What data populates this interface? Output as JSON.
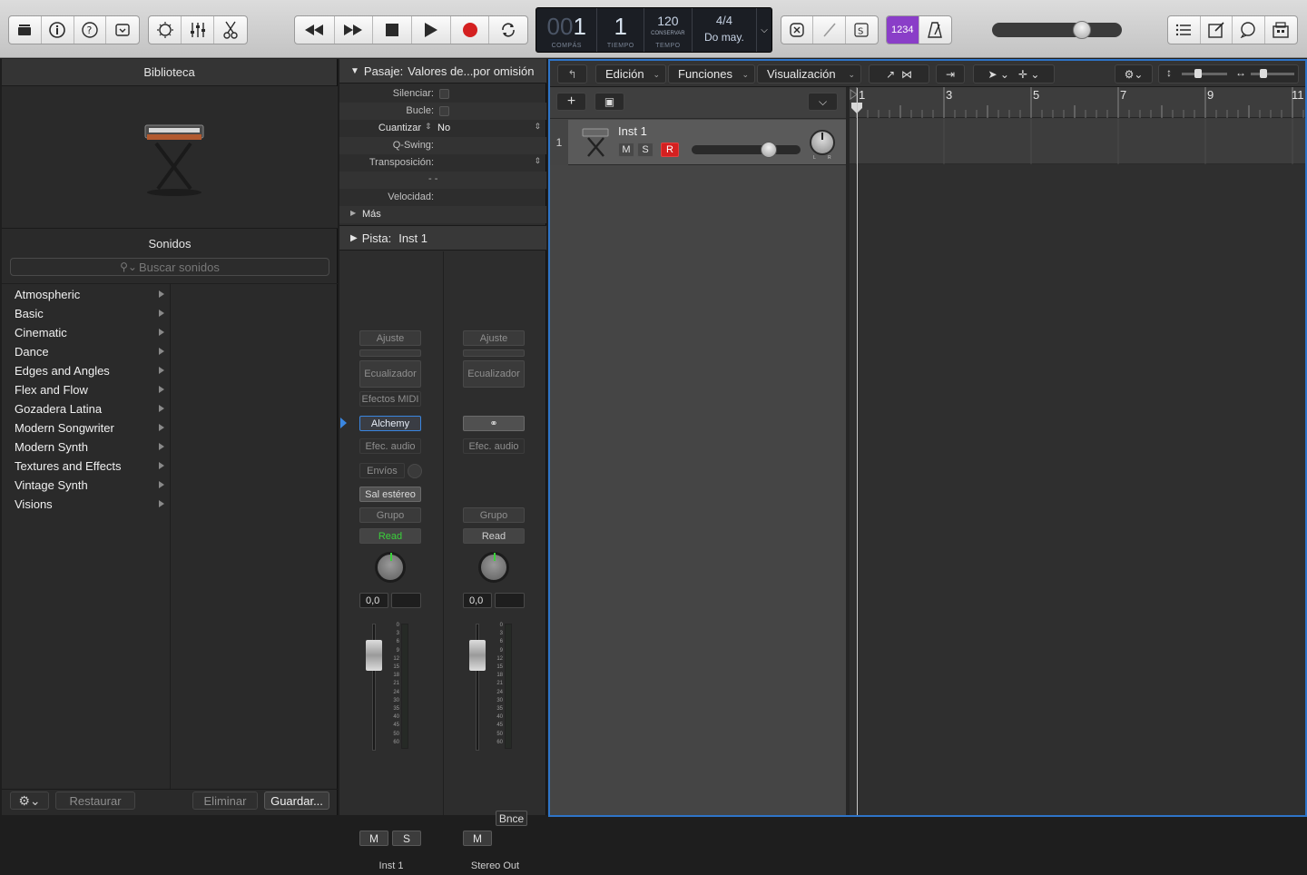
{
  "toolbar": {
    "left_icons": [
      "library-icon",
      "info-icon",
      "help-icon",
      "editor-toggle-icon"
    ],
    "mid_icons": [
      "smart-controls-icon",
      "mixer-icon",
      "scissors-icon"
    ],
    "transport": [
      "rewind-icon",
      "fast-forward-icon",
      "stop-icon",
      "play-icon",
      "record-icon",
      "cycle-icon"
    ],
    "lcd": {
      "bar_dim": "00",
      "bar": "1",
      "beat": "1",
      "bar_caption": "COMPÁS",
      "beat_caption": "TIEMPO",
      "tempo": "120",
      "tempo_caption1": "CONSERVAR",
      "tempo_caption2": "TEMPO",
      "signature": "4/4",
      "key": "Do may."
    },
    "countin": "1234",
    "master_volume": 0.7
  },
  "library": {
    "title": "Biblioteca",
    "sounds_title": "Sonidos",
    "search_placeholder": "Buscar sonidos",
    "categories": [
      "Atmospheric",
      "Basic",
      "Cinematic",
      "Dance",
      "Edges and Angles",
      "Flex and Flow",
      "Gozadera Latina",
      "Modern Songwriter",
      "Modern Synth",
      "Textures and Effects",
      "Vintage Synth",
      "Visions"
    ],
    "restore": "Restaurar",
    "delete": "Eliminar",
    "save": "Guardar..."
  },
  "inspector": {
    "region_label": "Pasaje:",
    "region_name": "Valores de...por omisión",
    "mute": "Silenciar:",
    "loop": "Bucle:",
    "quantize": "Cuantizar",
    "quantize_value": "No",
    "qswing": "Q-Swing:",
    "transpose": "Transposición:",
    "dash": "- -",
    "velocity": "Velocidad:",
    "more": "Más",
    "track_label": "Pista:",
    "track_name": "Inst 1",
    "strip1": {
      "setting": "Ajuste",
      "eq": "Ecualizador",
      "midi_fx": "Efectos MIDI",
      "instrument": "Alchemy",
      "audio_fx": "Efec. audio",
      "sends": "Envíos",
      "output": "Sal estéreo",
      "group": "Grupo",
      "automation": "Read",
      "volume": "0,0",
      "mute": "M",
      "solo": "S",
      "name": "Inst 1"
    },
    "strip2": {
      "setting": "Ajuste",
      "eq": "Ecualizador",
      "audio_fx": "Efec. audio",
      "group": "Grupo",
      "automation": "Read",
      "volume": "0,0",
      "bounce": "Bnce",
      "mute": "M",
      "name": "Stereo Out"
    },
    "meter_scale": [
      "0",
      "3",
      "6",
      "9",
      "12",
      "15",
      "18",
      "21",
      "24",
      "30",
      "35",
      "40",
      "45",
      "50",
      "60"
    ]
  },
  "tracks": {
    "menus": [
      "Edición",
      "Funciones",
      "Visualización"
    ],
    "track": {
      "number": "1",
      "name": "Inst 1",
      "mute": "M",
      "solo": "S",
      "record": "R",
      "pan_l": "L",
      "pan_r": "R"
    },
    "ruler": [
      "1",
      "3",
      "5",
      "7",
      "9",
      "11"
    ]
  },
  "colors": {
    "accent_blue": "#2e74c8",
    "record_red": "#d42020",
    "read_green": "#3ad13a",
    "countin_purple": "#8a3ec8"
  }
}
